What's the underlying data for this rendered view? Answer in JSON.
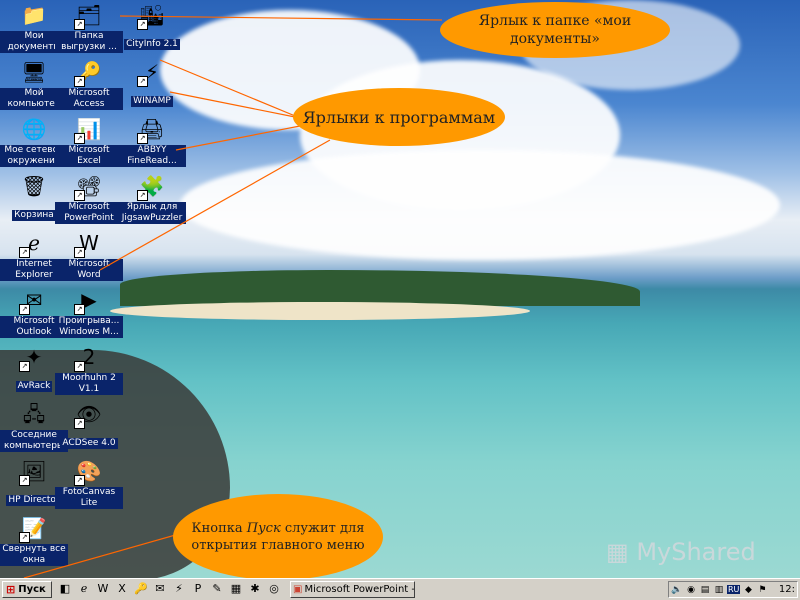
{
  "desktop": {
    "icons": [
      {
        "label": "Мои документы",
        "icon": "folder-icon",
        "glyph": "📁"
      },
      {
        "label": "Папка выгрузки ...",
        "icon": "web-folder-icon",
        "glyph": "🗂"
      },
      {
        "label": "CityInfo 2.1",
        "icon": "cityinfo-icon",
        "glyph": "🏙"
      },
      {
        "label": "Мой компьютер",
        "icon": "computer-icon",
        "glyph": "🖥"
      },
      {
        "label": "Microsoft Access",
        "icon": "access-icon",
        "glyph": "🔑"
      },
      {
        "label": "WINAMP",
        "icon": "winamp-icon",
        "glyph": "⚡"
      },
      {
        "label": "Мое сетевое окружение",
        "icon": "network-icon",
        "glyph": "🌐"
      },
      {
        "label": "Microsoft Excel",
        "icon": "excel-icon",
        "glyph": "📊"
      },
      {
        "label": "ABBYY FineRead...",
        "icon": "abbyy-icon",
        "glyph": "🖨"
      },
      {
        "label": "Корзина",
        "icon": "recycle-bin-icon",
        "glyph": "🗑"
      },
      {
        "label": "Microsoft PowerPoint",
        "icon": "powerpoint-icon",
        "glyph": "📽"
      },
      {
        "label": "Ярлык для JigsawPuzzler",
        "icon": "puzzle-icon",
        "glyph": "🧩"
      },
      {
        "label": "Internet Explorer",
        "icon": "ie-icon",
        "glyph": "ℯ"
      },
      {
        "label": "Microsoft Word",
        "icon": "word-icon",
        "glyph": "W"
      },
      {
        "label": "Microsoft Outlook",
        "icon": "outlook-icon",
        "glyph": "✉"
      },
      {
        "label": "Проигрыва... Windows M...",
        "icon": "media-player-icon",
        "glyph": "▶"
      },
      {
        "label": "AvRack",
        "icon": "avrack-icon",
        "glyph": "✦"
      },
      {
        "label": "Moorhuhn 2 V1.1",
        "icon": "moorhuhn-icon",
        "glyph": "2"
      },
      {
        "label": "Соседние компьютеры",
        "icon": "neighbors-icon",
        "glyph": "🖧"
      },
      {
        "label": "ACDSee 4.0",
        "icon": "acdsee-icon",
        "glyph": "👁"
      },
      {
        "label": "HP Director",
        "icon": "hp-director-icon",
        "glyph": "🖼"
      },
      {
        "label": "FotoCanvas Lite",
        "icon": "fotocanvas-icon",
        "glyph": "🎨"
      },
      {
        "label": "Свернуть все окна",
        "icon": "show-desktop-icon",
        "glyph": "📝"
      }
    ]
  },
  "callouts": {
    "docs": "Ярлык к папке «мои документы»",
    "programs": "Ярлыки к программам",
    "start_part1": "Кнопка ",
    "start_italic": "Пуск",
    "start_part2": " служит для открытия главного меню"
  },
  "watermark": "MyShared",
  "taskbar": {
    "start_label": "Пуск",
    "quick_launch": [
      "quicklaunch-icon",
      "ie-icon",
      "word-icon",
      "excel-icon",
      "access-icon",
      "outlook-icon",
      "winamp-icon",
      "powerpoint-icon",
      "tools-icon",
      "abbyy-icon",
      "puzzle-icon",
      "acdsee-icon"
    ],
    "task_button_label": "Microsoft PowerPoint - [о...",
    "tray_lang": "RU",
    "clock": "12:"
  }
}
